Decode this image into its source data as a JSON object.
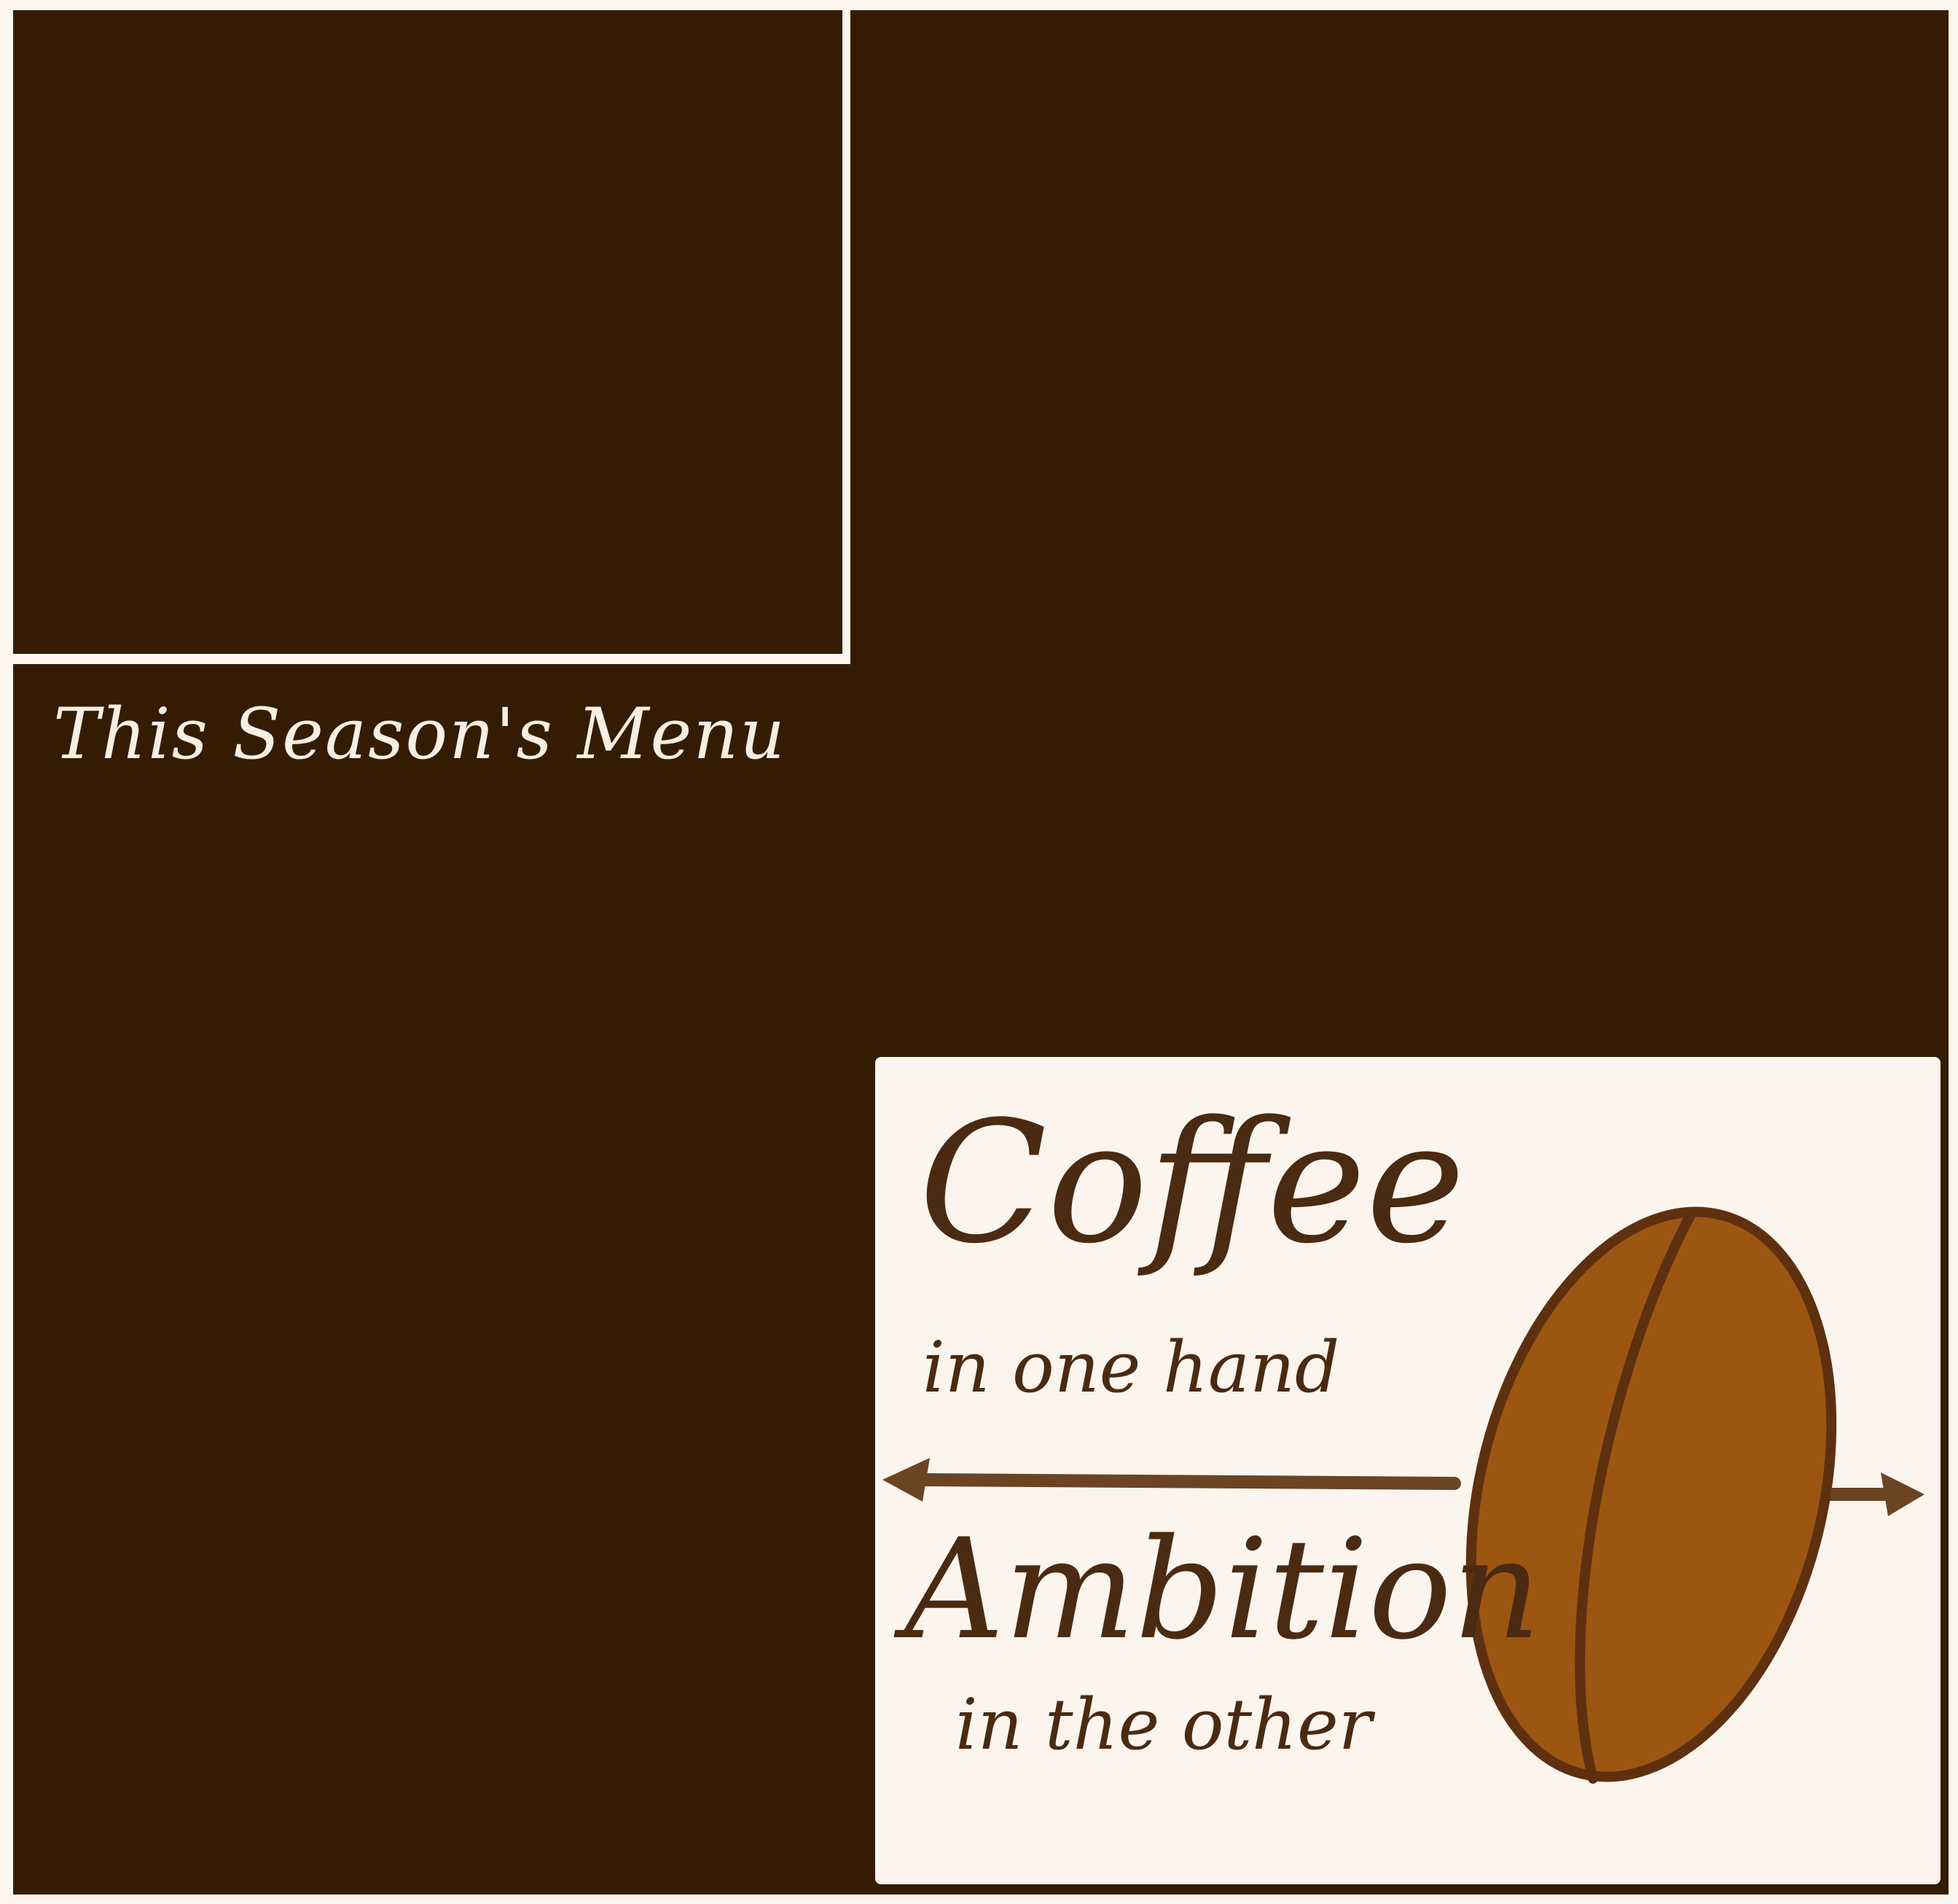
{
  "menu_panel": {
    "title": "This Season's Menu"
  },
  "sign": {
    "line1": "Coffee",
    "line2": "in one hand",
    "line3": "Ambition",
    "line4": "in the other"
  },
  "colors": {
    "board": "#341c03",
    "frame": "#fbf6ee",
    "ink": "#4b2a12",
    "bean": "#9c5612",
    "bean_outline": "#5e3010",
    "arrow": "#6b4424"
  }
}
